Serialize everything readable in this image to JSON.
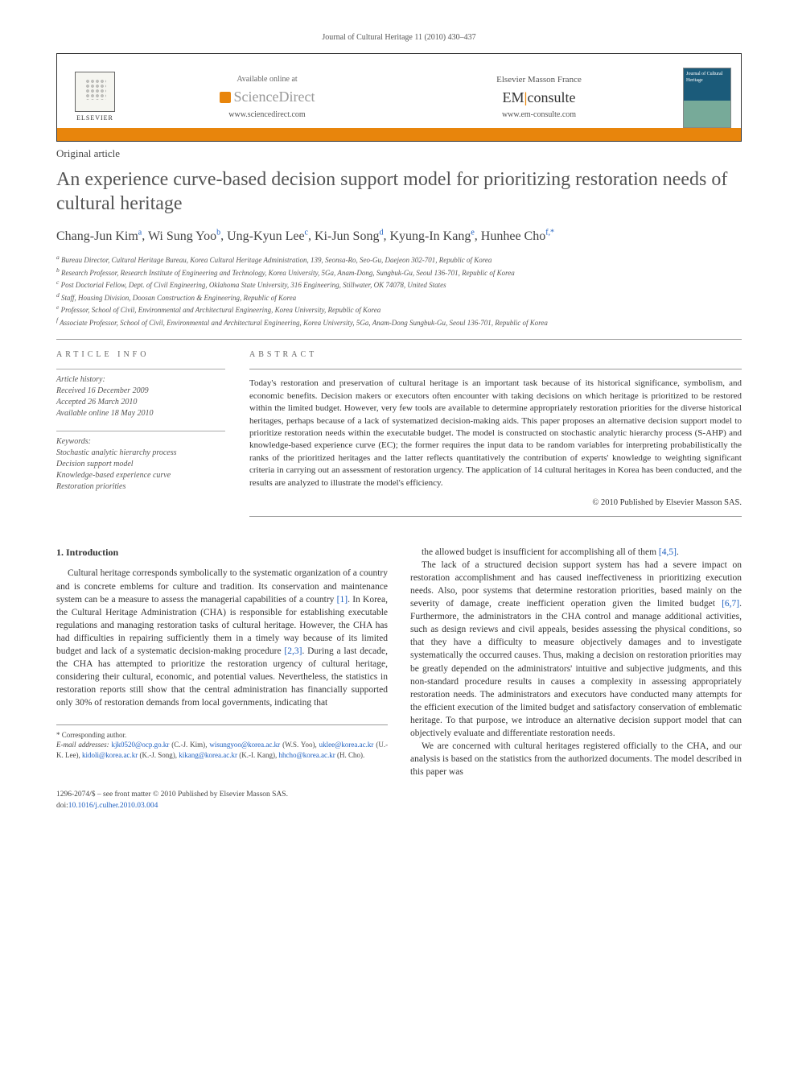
{
  "journal_header": "Journal of Cultural Heritage 11 (2010) 430–437",
  "banner": {
    "elsevier": "ELSEVIER",
    "sd_available": "Available online at",
    "sd_name": "ScienceDirect",
    "sd_url": "www.sciencedirect.com",
    "em_title": "Elsevier Masson France",
    "em_name_a": "EM",
    "em_name_b": "consulte",
    "em_url": "www.em-consulte.com",
    "cover_title": "Journal of Cultural Heritage"
  },
  "article_type": "Original article",
  "title": "An experience curve-based decision support model for prioritizing restoration needs of cultural heritage",
  "authors": [
    {
      "name": "Chang-Jun Kim",
      "sup": "a"
    },
    {
      "name": "Wi Sung Yoo",
      "sup": "b"
    },
    {
      "name": "Ung-Kyun Lee",
      "sup": "c"
    },
    {
      "name": "Ki-Jun Song",
      "sup": "d"
    },
    {
      "name": "Kyung-In Kang",
      "sup": "e"
    },
    {
      "name": "Hunhee Cho",
      "sup": "f,*"
    }
  ],
  "affiliations": {
    "a": "Bureau Director, Cultural Heritage Bureau, Korea Cultural Heritage Administration, 139, Seonsa-Ro, Seo-Gu, Daejeon 302-701, Republic of Korea",
    "b": "Research Professor, Research Institute of Engineering and Technology, Korea University, 5Ga, Anam-Dong, Sungbuk-Gu, Seoul 136-701, Republic of Korea",
    "c": "Post Doctorial Fellow, Dept. of Civil Engineering, Oklahoma State University, 316 Engineering, Stillwater, OK 74078, United States",
    "d": "Staff, Housing Division, Doosan Construction & Engineering, Republic of Korea",
    "e": "Professor, School of Civil, Environmental and Architectural Engineering, Korea University, Republic of Korea",
    "f": "Associate Professor, School of Civil, Environmental and Architectural Engineering, Korea University, 5Ga, Anam-Dong Sungbuk-Gu, Seoul 136-701, Republic of Korea"
  },
  "article_info": {
    "label": "ARTICLE INFO",
    "history_label": "Article history:",
    "received": "Received 16 December 2009",
    "accepted": "Accepted 26 March 2010",
    "online": "Available online 18 May 2010",
    "keywords_label": "Keywords:",
    "keywords": [
      "Stochastic analytic hierarchy process",
      "Decision support model",
      "Knowledge-based experience curve",
      "Restoration priorities"
    ]
  },
  "abstract": {
    "label": "ABSTRACT",
    "text": "Today's restoration and preservation of cultural heritage is an important task because of its historical significance, symbolism, and economic benefits. Decision makers or executors often encounter with taking decisions on which heritage is prioritized to be restored within the limited budget. However, very few tools are available to determine appropriately restoration priorities for the diverse historical heritages, perhaps because of a lack of systematized decision-making aids. This paper proposes an alternative decision support model to prioritize restoration needs within the executable budget. The model is constructed on stochastic analytic hierarchy process (S-AHP) and knowledge-based experience curve (EC); the former requires the input data to be random variables for interpreting probabilistically the ranks of the prioritized heritages and the latter reflects quantitatively the contribution of experts' knowledge to weighting significant criteria in carrying out an assessment of restoration urgency. The application of 14 cultural heritages in Korea has been conducted, and the results are analyzed to illustrate the model's efficiency.",
    "copyright": "© 2010 Published by Elsevier Masson SAS."
  },
  "body": {
    "section_heading": "1. Introduction",
    "col1_p1": "Cultural heritage corresponds symbolically to the systematic organization of a country and is concrete emblems for culture and tradition. Its conservation and maintenance system can be a measure to assess the managerial capabilities of a country [1]. In Korea, the Cultural Heritage Administration (CHA) is responsible for establishing executable regulations and managing restoration tasks of cultural heritage. However, the CHA has had difficulties in repairing sufficiently them in a timely way because of its limited budget and lack of a systematic decision-making procedure [2,3]. During a last decade, the CHA has attempted to prioritize the restoration urgency of cultural heritage, considering their cultural, economic, and potential values. Nevertheless, the statistics in restoration reports still show that the central administration has financially supported only 30% of restoration demands from local governments, indicating that",
    "col2_p1": "the allowed budget is insufficient for accomplishing all of them [4,5].",
    "col2_p2": "The lack of a structured decision support system has had a severe impact on restoration accomplishment and has caused ineffectiveness in prioritizing execution needs. Also, poor systems that determine restoration priorities, based mainly on the severity of damage, create inefficient operation given the limited budget [6,7]. Furthermore, the administrators in the CHA control and manage additional activities, such as design reviews and civil appeals, besides assessing the physical conditions, so that they have a difficulty to measure objectively damages and to investigate systematically the occurred causes. Thus, making a decision on restoration priorities may be greatly depended on the administrators' intuitive and subjective judgments, and this non-standard procedure results in causes a complexity in assessing appropriately restoration needs. The administrators and executors have conducted many attempts for the efficient execution of the limited budget and satisfactory conservation of emblematic heritage. To that purpose, we introduce an alternative decision support model that can objectively evaluate and differentiate restoration needs.",
    "col2_p3": "We are concerned with cultural heritages registered officially to the CHA, and our analysis is based on the statistics from the authorized documents. The model described in this paper was"
  },
  "footnotes": {
    "corresponding": "* Corresponding author.",
    "email_label": "E-mail addresses:",
    "emails": [
      {
        "addr": "kjk0520@ocp.go.kr",
        "who": "(C.-J. Kim)"
      },
      {
        "addr": "wisungyoo@korea.ac.kr",
        "who": "(W.S. Yoo)"
      },
      {
        "addr": "uklee@korea.ac.kr",
        "who": "(U.-K. Lee)"
      },
      {
        "addr": "kidoli@korea.ac.kr",
        "who": "(K.-J. Song)"
      },
      {
        "addr": "kikang@korea.ac.kr",
        "who": "(K.-I. Kang)"
      },
      {
        "addr": "hhcho@korea.ac.kr",
        "who": "(H. Cho)"
      }
    ]
  },
  "footer": {
    "issn": "1296-2074/$ – see front matter © 2010 Published by Elsevier Masson SAS.",
    "doi_label": "doi:",
    "doi": "10.1016/j.culher.2010.03.004"
  }
}
